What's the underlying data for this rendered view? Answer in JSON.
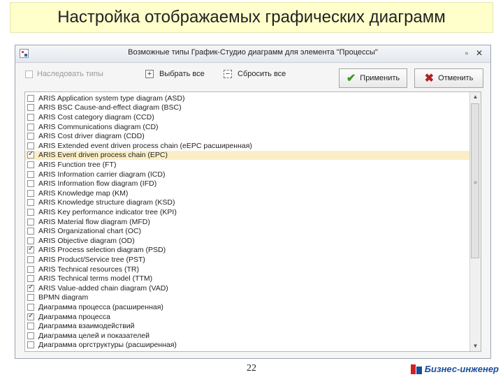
{
  "slide": {
    "title": "Настройка отображаемых графических диаграмм",
    "page_number": "22",
    "brand": "Бизнес-инженер"
  },
  "window": {
    "title": "Возможные типы График-Студио диаграмм для элемента \"Процессы\"",
    "controls": {
      "restore": "▫",
      "close": "✕"
    }
  },
  "toolbar": {
    "inherit_label": "Наследовать типы",
    "select_all_label": "Выбрать все",
    "reset_all_label": "Сбросить все",
    "apply_label": "Применить",
    "cancel_label": "Отменить"
  },
  "list": {
    "items": [
      {
        "label": "ARIS Application system type diagram (ASD)",
        "checked": false
      },
      {
        "label": "ARIS BSC Cause-and-effect diagram (BSC)",
        "checked": false
      },
      {
        "label": "ARIS Cost category diagram (CCD)",
        "checked": false
      },
      {
        "label": "ARIS Communications diagram (CD)",
        "checked": false
      },
      {
        "label": "ARIS Cost driver diagram (CDD)",
        "checked": false
      },
      {
        "label": "ARIS Extended event driven process chain (eEPC расширенная)",
        "checked": false
      },
      {
        "label": "ARIS Event driven process chain (EPC)",
        "checked": true,
        "highlighted": true
      },
      {
        "label": "ARIS Function tree (FT)",
        "checked": false
      },
      {
        "label": "ARIS Information carrier diagram (ICD)",
        "checked": false
      },
      {
        "label": "ARIS Information flow diagram (IFD)",
        "checked": false
      },
      {
        "label": "ARIS Knowledge map (KM)",
        "checked": false
      },
      {
        "label": "ARIS Knowledge structure diagram (KSD)",
        "checked": false
      },
      {
        "label": "ARIS Key performance indicator tree (KPI)",
        "checked": false
      },
      {
        "label": "ARIS Material flow diagram (MFD)",
        "checked": false
      },
      {
        "label": "ARIS Organizational chart (OC)",
        "checked": false
      },
      {
        "label": "ARIS Objective diagram (OD)",
        "checked": false
      },
      {
        "label": "ARIS Process selection diagram (PSD)",
        "checked": true
      },
      {
        "label": "ARIS Product/Service tree (PST)",
        "checked": false
      },
      {
        "label": "ARIS Technical resources (TR)",
        "checked": false
      },
      {
        "label": "ARIS Technical terms model (TTM)",
        "checked": false
      },
      {
        "label": "ARIS Value-added chain diagram (VAD)",
        "checked": true
      },
      {
        "label": "BPMN diagram",
        "checked": false
      },
      {
        "label": "Диаграмма процесса (расширенная)",
        "checked": false
      },
      {
        "label": "Диаграмма процесса",
        "checked": true
      },
      {
        "label": "Диаграмма взаимодействий",
        "checked": false
      },
      {
        "label": "Диаграмма целей и показателей",
        "checked": false
      },
      {
        "label": "Диаграмма оргструктуры (расширенная)",
        "checked": false
      }
    ]
  },
  "icons": {
    "apply": "check-icon",
    "cancel": "cross-icon"
  }
}
